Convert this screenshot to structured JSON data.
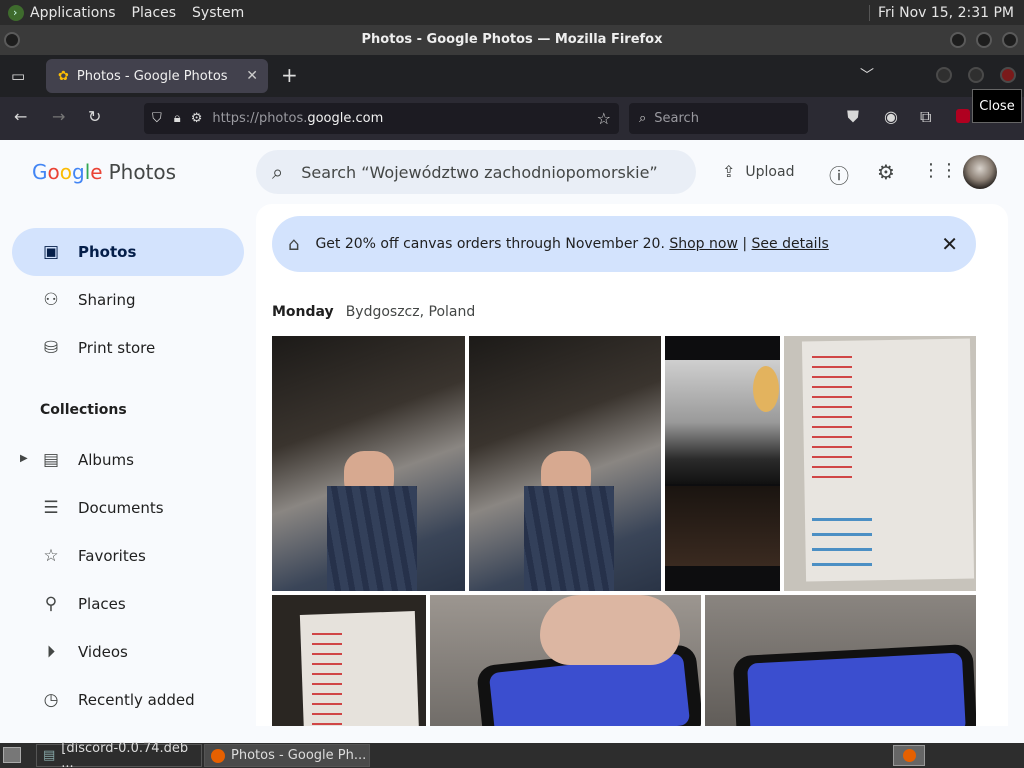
{
  "system_bar": {
    "menus": [
      "Applications",
      "Places",
      "System"
    ],
    "clock": "Fri Nov 15,  2:31 PM"
  },
  "window": {
    "title": "Photos - Google Photos — Mozilla Firefox"
  },
  "browser": {
    "tab_title": "Photos - Google Photos",
    "url_scheme": "https://photos.",
    "url_host": "google.com",
    "search_placeholder": "Search",
    "close_tooltip": "Close"
  },
  "app": {
    "logo_google": [
      "G",
      "o",
      "o",
      "g",
      "l",
      "e"
    ],
    "logo_colors": [
      "#4285f4",
      "#ea4335",
      "#fbbc04",
      "#4285f4",
      "#34a853",
      "#ea4335"
    ],
    "logo_product": "Photos",
    "search_placeholder": "Search “Województwo zachodniopomorskie”",
    "upload_label": "Upload"
  },
  "sidebar": {
    "items": [
      {
        "label": "Photos",
        "icon": "photo-icon",
        "selected": true
      },
      {
        "label": "Sharing",
        "icon": "people-icon"
      },
      {
        "label": "Print store",
        "icon": "bag-icon"
      }
    ],
    "collections_header": "Collections",
    "collections": [
      {
        "label": "Albums",
        "icon": "album-icon"
      },
      {
        "label": "Documents",
        "icon": "document-icon"
      },
      {
        "label": "Favorites",
        "icon": "star-icon"
      },
      {
        "label": "Places",
        "icon": "pin-icon"
      },
      {
        "label": "Videos",
        "icon": "play-icon"
      },
      {
        "label": "Recently added",
        "icon": "clock-icon"
      }
    ]
  },
  "promo": {
    "text": "Get 20% off canvas orders through November 20.",
    "link1": "Shop now",
    "separator": "|",
    "link2": "See details"
  },
  "day": {
    "name": "Monday",
    "place": "Bydgoszcz, Poland"
  },
  "taskbar": {
    "items": [
      "[discord-0.0.74.deb ...",
      "Photos - Google Ph..."
    ]
  },
  "colors": {
    "accent": "#d3e3fd",
    "link_dark": "#041e49"
  }
}
